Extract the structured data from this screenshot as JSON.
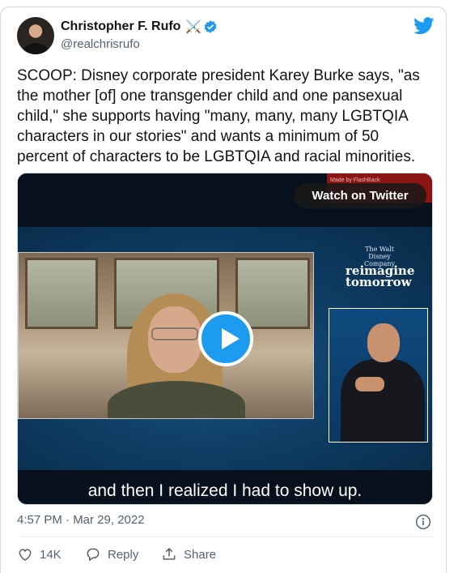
{
  "author": {
    "name": "Christopher F. Rufo",
    "name_emoji": "⚔️",
    "handle": "@realchrisrufo",
    "verified": true
  },
  "tweet": {
    "text": "SCOOP: Disney corporate president Karey Burke says, \"as the mother [of] one transgender child and one pansexual child,\" she supports having \"many, many, many LGBTQIA characters in our stories\" and wants a minimum of 50 percent of characters to be LGBTQIA and racial minorities.",
    "timestamp": "4:57 PM · Mar 29, 2022"
  },
  "media": {
    "watch_label": "Watch on Twitter",
    "made_by": "Made by FlashBack",
    "logo_company": "The Walt Disney Company",
    "logo_tagline": "reimagine tomorrow",
    "caption": "and then I realized I had to show up."
  },
  "actions": {
    "like_count": "14K",
    "reply_label": "Reply",
    "share_label": "Share"
  },
  "colors": {
    "accent": "#1d9bf0",
    "text_primary": "#0f1419",
    "text_secondary": "#536471"
  },
  "icons": [
    "avatar",
    "crossed-swords-icon",
    "verified-badge-icon",
    "twitter-bird-icon",
    "play-icon",
    "info-icon",
    "heart-icon",
    "reply-icon",
    "share-icon"
  ]
}
